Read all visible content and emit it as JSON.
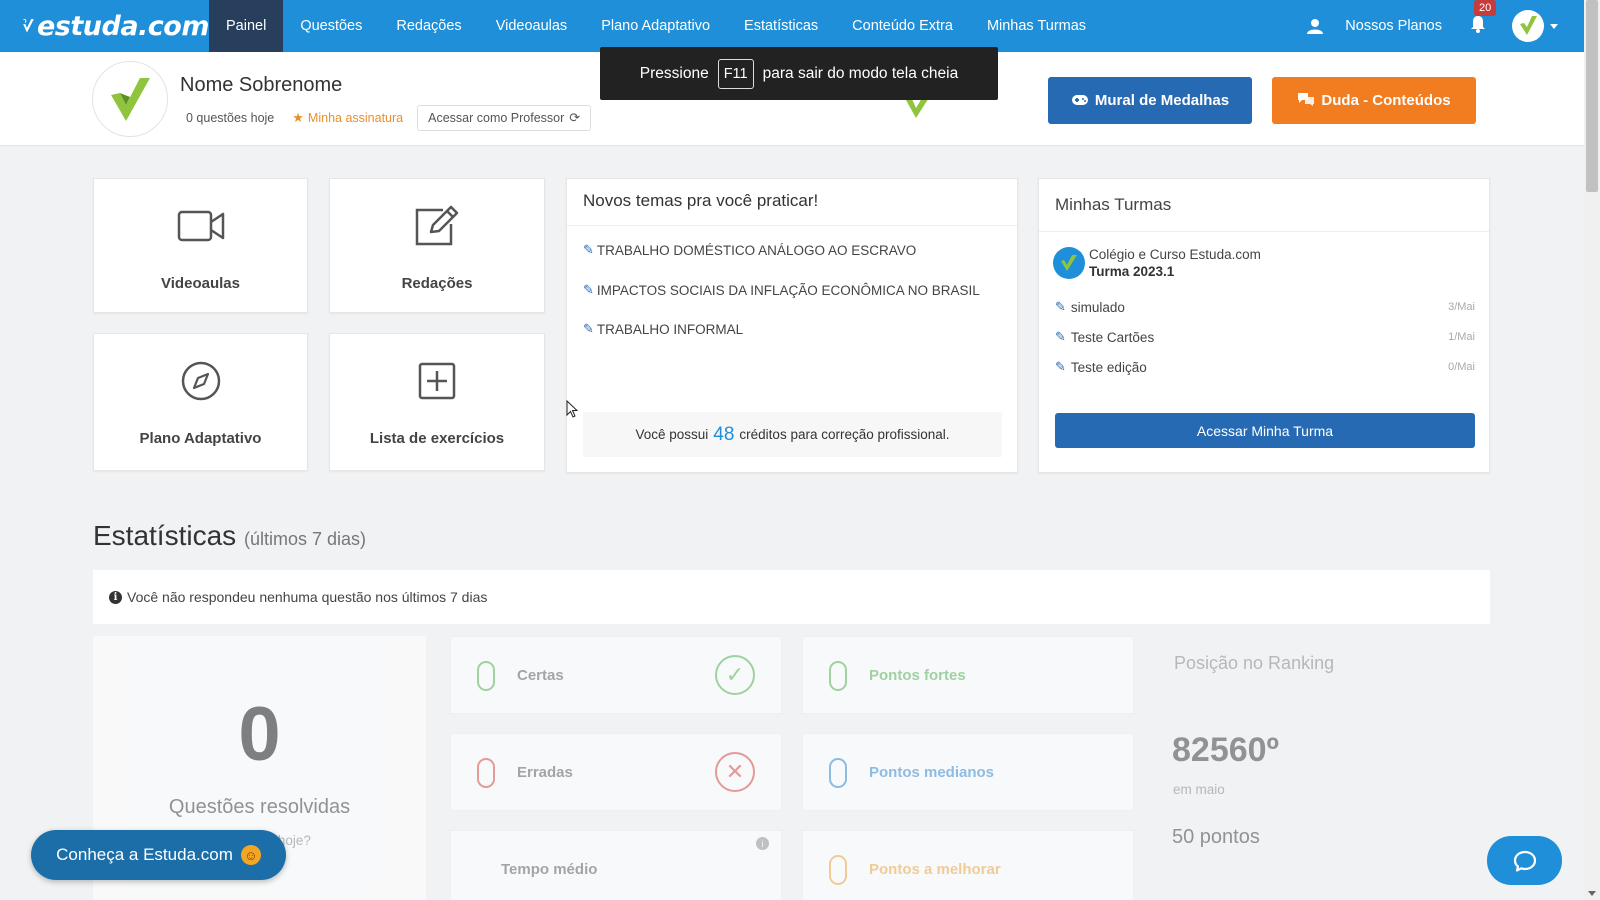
{
  "brand": {
    "name": "estuda.com"
  },
  "nav": {
    "items": [
      {
        "label": "Painel",
        "active": true
      },
      {
        "label": "Questões"
      },
      {
        "label": "Redações"
      },
      {
        "label": "Videoaulas"
      },
      {
        "label": "Plano Adaptativo"
      },
      {
        "label": "Estatísticas"
      },
      {
        "label": "Conteúdo Extra"
      },
      {
        "label": "Minhas Turmas"
      }
    ],
    "plans_label": "Nossos Planos",
    "notifications_count": "20"
  },
  "fullscreen_toast": {
    "prefix": "Pressione",
    "key": "F11",
    "suffix": "para sair do modo tela cheia"
  },
  "profile": {
    "name": "Nome Sobrenome",
    "questions_today": "0 questões hoje",
    "subscription_label": "Minha assinatura",
    "teacher_button": "Acessar como Professor",
    "medals_button": "Mural de Medalhas",
    "duda_button": "Duda - Conteúdos"
  },
  "tiles": [
    {
      "label": "Videoaulas",
      "icon": "video-camera-icon"
    },
    {
      "label": "Redações",
      "icon": "edit-icon"
    },
    {
      "label": "Plano Adaptativo",
      "icon": "compass-icon"
    },
    {
      "label": "Lista de exercícios",
      "icon": "plus-square-icon"
    }
  ],
  "themes": {
    "title": "Novos temas pra você praticar!",
    "items": [
      "TRABALHO DOMÉSTICO ANÁLOGO AO ESCRAVO",
      "IMPACTOS SOCIAIS DA INFLAÇÃO ECONÔMICA NO BRASIL",
      "TRABALHO INFORMAL"
    ],
    "credits_prefix": "Você possui",
    "credits_value": "48",
    "credits_suffix": "créditos para correção profissional."
  },
  "turmas": {
    "title": "Minhas Turmas",
    "school": "Colégio e Curso Estuda.com",
    "class_name": "Turma 2023.1",
    "items": [
      {
        "label": "simulado",
        "date": "3/Mai"
      },
      {
        "label": "Teste Cartões",
        "date": "1/Mai"
      },
      {
        "label": "Teste edição",
        "date": "0/Mai"
      }
    ],
    "button": "Acessar Minha Turma"
  },
  "stats": {
    "title": "Estatísticas",
    "subtitle": "(últimos 7 dias)",
    "info": "Você não respondeu nenhuma questão nos últimos 7 dias",
    "questions_count": "0",
    "questions_label": "Questões resolvidas",
    "questions_sub": "recimentos hoje?",
    "correct_label": "Certas",
    "wrong_label": "Erradas",
    "time_label": "Tempo médio",
    "strong_label": "Pontos fortes",
    "medium_label": "Pontos medianos",
    "improve_label": "Pontos a melhorar",
    "ranking_title": "Posição no Ranking",
    "ranking_position": "82560º",
    "ranking_when": "em maio",
    "ranking_points": "50 pontos"
  },
  "cta": {
    "label": "Conheça a Estuda.com"
  },
  "colors": {
    "primary": "#1e8fd8",
    "navy": "#276ab4",
    "orange": "#f27c20",
    "green": "#5cb85c",
    "red": "#d9534f"
  }
}
